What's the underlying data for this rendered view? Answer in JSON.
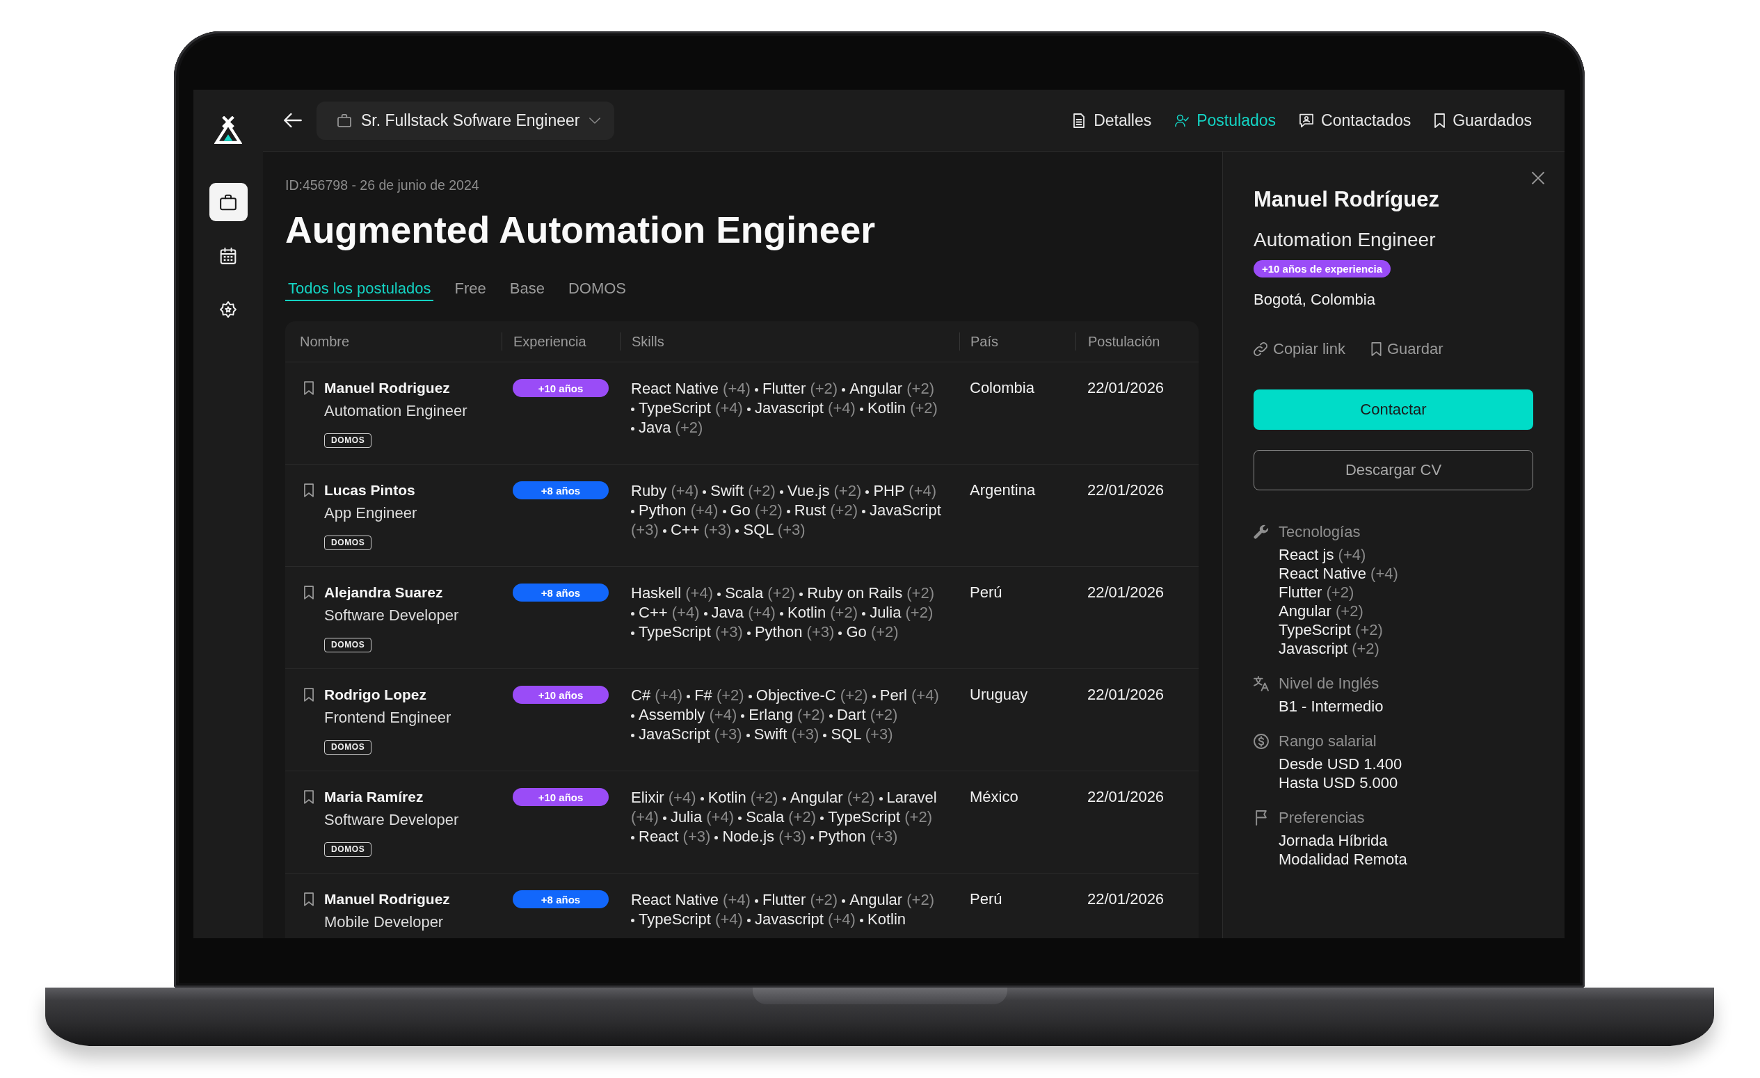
{
  "sidebar": {
    "items": [
      {
        "selected": true
      },
      {
        "selected": false
      },
      {
        "selected": false
      }
    ]
  },
  "top_bar": {
    "job_selector": {
      "value": "Sr. Fullstack Sofware Engineer"
    },
    "nav": [
      {
        "label": "Detalles",
        "selected": false
      },
      {
        "label": "Postulados",
        "selected": true
      },
      {
        "label": "Contactados",
        "selected": false
      },
      {
        "label": "Guardados",
        "selected": false
      }
    ]
  },
  "job": {
    "meta": "ID:456798 - 26 de junio de 2024",
    "title": "Augmented Automation Engineer",
    "tabs": [
      {
        "label": "Todos los postulados",
        "selected": true
      },
      {
        "label": "Free",
        "selected": false
      },
      {
        "label": "Base",
        "selected": false
      },
      {
        "label": "DOMOS",
        "selected": false
      }
    ]
  },
  "table": {
    "columns": [
      "Nombre",
      "Experiencia",
      "Skills",
      "País",
      "Postulación"
    ],
    "rows": [
      {
        "saved": false,
        "name": "Manuel Rodriguez",
        "role": "Automation Engineer",
        "tag": "DOMOS",
        "experience": {
          "label": "+10 años",
          "color": "#9a4cf7"
        },
        "skills": [
          {
            "name": "React Native",
            "years": "(+4)"
          },
          {
            "name": "Flutter",
            "years": "(+2)"
          },
          {
            "name": "Angular",
            "years": "(+2)"
          },
          {
            "name": "TypeScript",
            "years": "(+4)"
          },
          {
            "name": "Javascript",
            "years": "(+4)"
          },
          {
            "name": "Kotlin",
            "years": "(+2)"
          },
          {
            "name": "Java",
            "years": "(+2)"
          }
        ],
        "country": "Colombia",
        "date": "22/01/2026"
      },
      {
        "saved": false,
        "name": "Lucas Pintos",
        "role": "App Engineer",
        "tag": "DOMOS",
        "experience": {
          "label": "+8 años",
          "color": "#1267fb"
        },
        "skills": [
          {
            "name": "Ruby",
            "years": "(+4)"
          },
          {
            "name": "Swift",
            "years": "(+2)"
          },
          {
            "name": "Vue.js",
            "years": "(+2)"
          },
          {
            "name": "PHP",
            "years": "(+4)"
          },
          {
            "name": "Python",
            "years": "(+4)"
          },
          {
            "name": "Go",
            "years": "(+2)"
          },
          {
            "name": "Rust",
            "years": "(+2)"
          },
          {
            "name": "JavaScript",
            "years": "(+3)"
          },
          {
            "name": "C++",
            "years": "(+3)"
          },
          {
            "name": "SQL",
            "years": "(+3)"
          }
        ],
        "country": "Argentina",
        "date": "22/01/2026"
      },
      {
        "saved": false,
        "name": "Alejandra Suarez",
        "role": "Software Developer",
        "tag": "DOMOS",
        "experience": {
          "label": "+8 años",
          "color": "#1267fb"
        },
        "skills": [
          {
            "name": "Haskell",
            "years": "(+4)"
          },
          {
            "name": "Scala",
            "years": "(+2)"
          },
          {
            "name": "Ruby on Rails",
            "years": "(+2)"
          },
          {
            "name": "C++",
            "years": "(+4)"
          },
          {
            "name": "Java",
            "years": "(+4)"
          },
          {
            "name": "Kotlin",
            "years": "(+2)"
          },
          {
            "name": "Julia",
            "years": "(+2)"
          },
          {
            "name": "TypeScript",
            "years": "(+3)"
          },
          {
            "name": "Python",
            "years": "(+3)"
          },
          {
            "name": "Go",
            "years": "(+2)"
          }
        ],
        "country": "Perú",
        "date": "22/01/2026"
      },
      {
        "saved": false,
        "name": "Rodrigo Lopez",
        "role": "Frontend Engineer",
        "tag": "DOMOS",
        "experience": {
          "label": "+10 años",
          "color": "#9a4cf7"
        },
        "skills": [
          {
            "name": "C#",
            "years": "(+4)"
          },
          {
            "name": "F#",
            "years": "(+2)"
          },
          {
            "name": "Objective-C",
            "years": "(+2)"
          },
          {
            "name": "Perl",
            "years": "(+4)"
          },
          {
            "name": "Assembly",
            "years": "(+4)"
          },
          {
            "name": "Erlang",
            "years": "(+2)"
          },
          {
            "name": "Dart",
            "years": "(+2)"
          },
          {
            "name": "JavaScript",
            "years": "(+3)"
          },
          {
            "name": "Swift",
            "years": "(+3)"
          },
          {
            "name": "SQL",
            "years": "(+3)"
          }
        ],
        "country": "Uruguay",
        "date": "22/01/2026"
      },
      {
        "saved": false,
        "name": "Maria Ramírez",
        "role": "Software Developer",
        "tag": "DOMOS",
        "experience": {
          "label": "+10 años",
          "color": "#9a4cf7"
        },
        "skills": [
          {
            "name": "Elixir",
            "years": "(+4)"
          },
          {
            "name": "Kotlin",
            "years": "(+2)"
          },
          {
            "name": "Angular",
            "years": "(+2)"
          },
          {
            "name": "Laravel",
            "years": "(+4)"
          },
          {
            "name": "Julia",
            "years": "(+4)"
          },
          {
            "name": "Scala",
            "years": "(+2)"
          },
          {
            "name": "TypeScript",
            "years": "(+2)"
          },
          {
            "name": "React",
            "years": "(+3)"
          },
          {
            "name": "Node.js",
            "years": "(+3)"
          },
          {
            "name": "Python",
            "years": "(+3)"
          }
        ],
        "country": "México",
        "date": "22/01/2026"
      },
      {
        "saved": false,
        "name": "Manuel Rodriguez",
        "role": "Mobile Developer",
        "experience": {
          "label": "+8 años",
          "color": "#1267fb"
        },
        "skills": [
          {
            "name": "React Native",
            "years": "(+4)"
          },
          {
            "name": "Flutter",
            "years": "(+2)"
          },
          {
            "name": "Angular",
            "years": "(+2)"
          },
          {
            "name": "TypeScript",
            "years": "(+4)"
          },
          {
            "name": "Javascript",
            "years": "(+4)"
          },
          {
            "name": "Kotlin"
          }
        ],
        "country": "Perú",
        "date": "22/01/2026"
      }
    ]
  },
  "detail_panel": {
    "name": "Manuel Rodríguez",
    "role": "Automation Engineer",
    "experience": {
      "label": "+10 años de experiencia",
      "color": "#9a4cf7"
    },
    "location": "Bogotá, Colombia",
    "actions": [
      {
        "label": "Copiar link"
      },
      {
        "label": "Guardar"
      }
    ],
    "buttons": [
      {
        "label": "Contactar",
        "kind": "primary"
      },
      {
        "label": "Descargar CV",
        "kind": "secondary"
      }
    ],
    "sections": [
      {
        "title": "Tecnologías",
        "items": [
          {
            "name": "React js",
            "years": "(+4)"
          },
          {
            "name": "React Native",
            "years": "(+4)"
          },
          {
            "name": "Flutter",
            "years": "(+2)"
          },
          {
            "name": "Angular",
            "years": "(+2)"
          },
          {
            "name": "TypeScript",
            "years": "(+2)"
          },
          {
            "name": "Javascript",
            "years": "(+2)"
          }
        ]
      },
      {
        "title": "Nivel de Inglés",
        "items": [
          {
            "name": "B1 - Intermedio"
          }
        ]
      },
      {
        "title": "Rango salarial",
        "items": [
          {
            "name": "Desde USD 1.400"
          },
          {
            "name": "Hasta USD 5.000"
          }
        ]
      },
      {
        "title": "Preferencias",
        "items": [
          {
            "name": "Jornada Híbrida"
          },
          {
            "name": "Modalidad Remota"
          }
        ]
      }
    ]
  }
}
